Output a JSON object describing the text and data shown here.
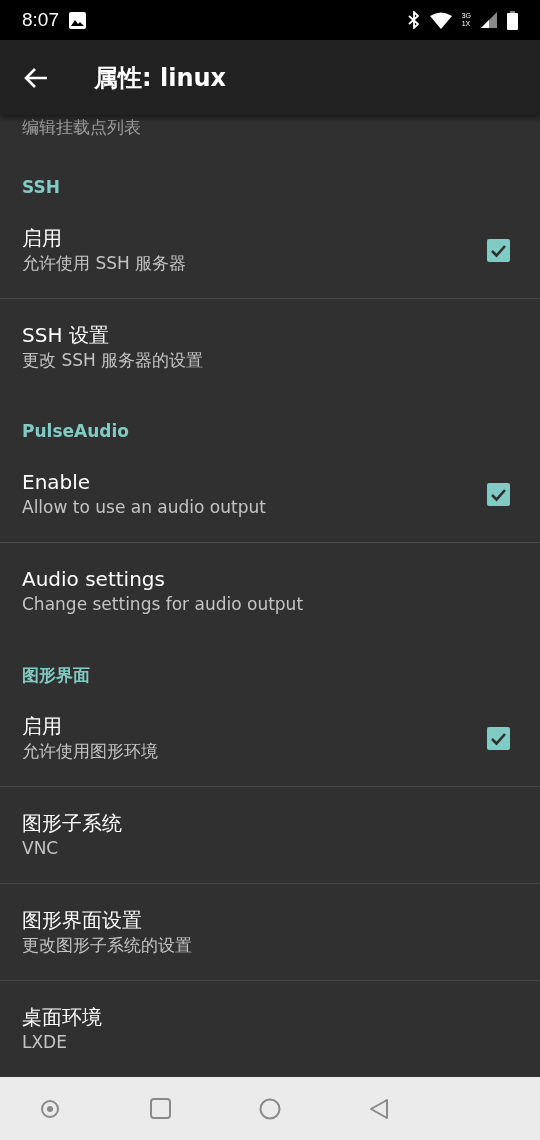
{
  "status_bar": {
    "time": "8:07",
    "network_labels": [
      "3G",
      "1X"
    ]
  },
  "app_bar": {
    "title": "属性: linux"
  },
  "partial_item": {
    "summary": "编辑挂载点列表"
  },
  "sections": [
    {
      "title": "SSH",
      "items": [
        {
          "kind": "checkbox",
          "title": "启用",
          "summary": "允许使用 SSH 服务器",
          "checked": true
        },
        {
          "kind": "plain",
          "title": "SSH 设置",
          "summary": "更改 SSH 服务器的设置"
        }
      ]
    },
    {
      "title": "PulseAudio",
      "items": [
        {
          "kind": "checkbox",
          "title": "Enable",
          "summary": "Allow to use an audio output",
          "checked": true
        },
        {
          "kind": "plain",
          "title": "Audio settings",
          "summary": "Change settings for audio output"
        }
      ]
    },
    {
      "title": "图形界面",
      "items": [
        {
          "kind": "checkbox",
          "title": "启用",
          "summary": "允许使用图形环境",
          "checked": true
        },
        {
          "kind": "plain",
          "title": "图形子系统",
          "summary": "VNC"
        },
        {
          "kind": "plain",
          "title": "图形界面设置",
          "summary": "更改图形子系统的设置"
        },
        {
          "kind": "plain",
          "title": "桌面环境",
          "summary": "LXDE"
        }
      ]
    }
  ]
}
